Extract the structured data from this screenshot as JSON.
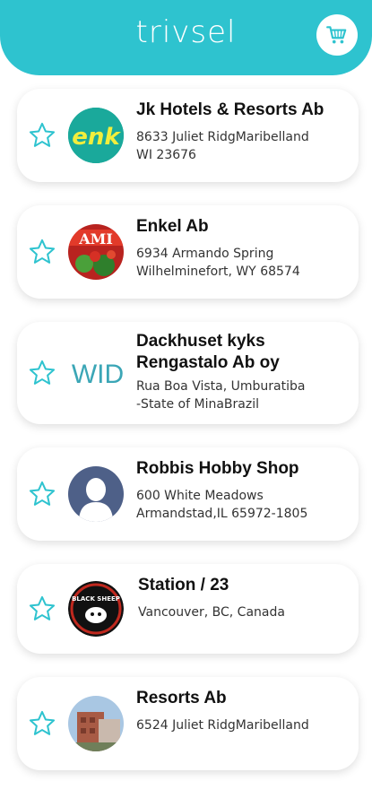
{
  "app": {
    "logo": "trivsel"
  },
  "header": {
    "cart_icon": "cart-icon",
    "color": "#2ec3cf"
  },
  "items": [
    {
      "name": "Jk Hotels & Resorts Ab",
      "address": [
        "8633 Juliet RidgMaribelland",
        "WI 23676"
      ],
      "logo_text": "enk",
      "icon": "star-outline-icon"
    },
    {
      "name": "Enkel Ab",
      "address": [
        "6934 Armando Spring",
        "Wilhelminefort, WY  68574"
      ],
      "logo_text": "AMI",
      "icon": "star-outline-icon"
    },
    {
      "name": [
        "Dackhuset kyks",
        "Rengastalo Ab oy"
      ],
      "address": [
        "Rua Boa Vista, Umburatiba",
        "-State of MinaBrazil"
      ],
      "logo_text": "WID",
      "icon": "star-outline-icon"
    },
    {
      "name": "Robbis Hobby Shop",
      "address": [
        "600 White Meadows",
        "Armandstad,IL 65972-1805"
      ],
      "icon": "star-outline-icon"
    },
    {
      "name": "Station / 23",
      "address": [
        "Vancouver, BC, Canada"
      ],
      "logo_text": "BLACK SHEEP",
      "icon": "star-outline-icon"
    },
    {
      "name": "Resorts Ab",
      "address": [
        "6524 Juliet RidgMaribelland"
      ],
      "icon": "star-outline-icon"
    }
  ]
}
